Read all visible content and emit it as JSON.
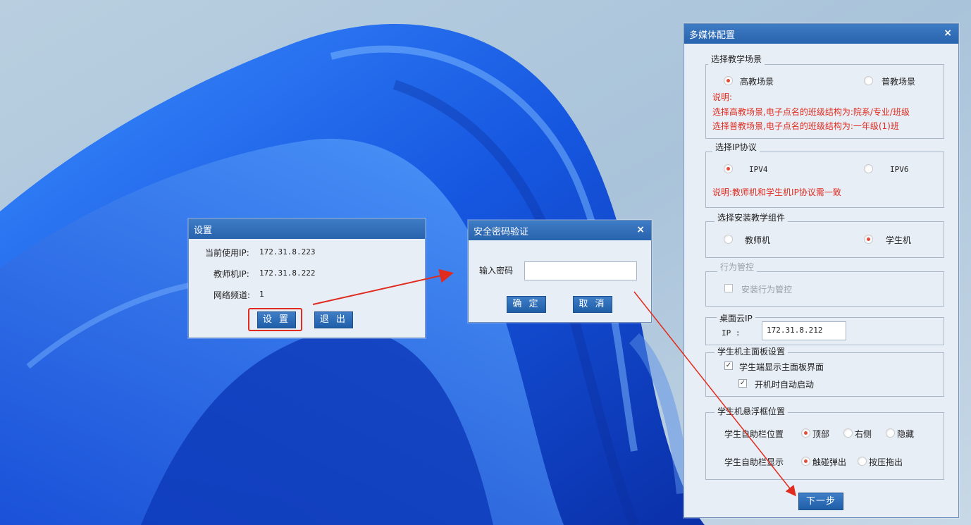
{
  "settings_dialog": {
    "title": "设置",
    "current_ip_label": "当前使用IP:",
    "current_ip": "172.31.8.223",
    "teacher_ip_label": "教师机IP:",
    "teacher_ip": "172.31.8.222",
    "channel_label": "网络频道:",
    "channel": "1",
    "settings_button": "设 置",
    "exit_button": "退 出"
  },
  "password_dialog": {
    "title": "安全密码验证",
    "password_label": "输入密码",
    "password_value": "",
    "confirm_button": "确 定",
    "cancel_button": "取 消",
    "close_glyph": "×"
  },
  "config_dialog": {
    "title": "多媒体配置",
    "close_glyph": "×",
    "scene": {
      "legend": "选择教学场景",
      "options": [
        {
          "label": "高教场景",
          "selected": true
        },
        {
          "label": "普教场景",
          "selected": false
        }
      ],
      "note_title": "说明:",
      "note_lines": [
        "选择高教场景,电子点名的班级结构为:院系/专业/班级",
        "选择普教场景,电子点名的班级结构为:一年级(1)班"
      ]
    },
    "ip_protocol": {
      "legend": "选择IP协议",
      "options": [
        {
          "label": "IPV4",
          "selected": true
        },
        {
          "label": "IPV6",
          "selected": false
        }
      ],
      "note": "说明:教师机和学生机IP协议需一致"
    },
    "component": {
      "legend": "选择安装教学组件",
      "options": [
        {
          "label": "教师机",
          "selected": false
        },
        {
          "label": "学生机",
          "selected": true
        }
      ]
    },
    "behavior": {
      "legend": "行为管控",
      "checkbox_label": "安装行为管控",
      "checked": false
    },
    "desktop_cloud": {
      "legend": "桌面云IP",
      "ip_label": "IP :",
      "ip_value": "172.31.8.212"
    },
    "student_panel": {
      "legend": "学生机主面板设置",
      "show_main_panel": {
        "label": "学生端显示主面板界面",
        "checked": true
      },
      "autostart": {
        "label": "开机时自动启动",
        "checked": true
      }
    },
    "float_position": {
      "legend": "学生机悬浮框位置",
      "toolbar_position_label": "学生自助栏位置",
      "toolbar_position_options": [
        {
          "label": "顶部",
          "selected": true
        },
        {
          "label": "右侧",
          "selected": false
        },
        {
          "label": "隐藏",
          "selected": false
        }
      ],
      "toolbar_display_label": "学生自助栏显示",
      "toolbar_display_options": [
        {
          "label": "触碰弹出",
          "selected": true
        },
        {
          "label": "按压拖出",
          "selected": false
        }
      ]
    },
    "next_button": "下一步"
  },
  "colors": {
    "accent": "#2a68b1",
    "annotation_red": "#e02b1e",
    "desktop_blue": "#1a5de0"
  }
}
